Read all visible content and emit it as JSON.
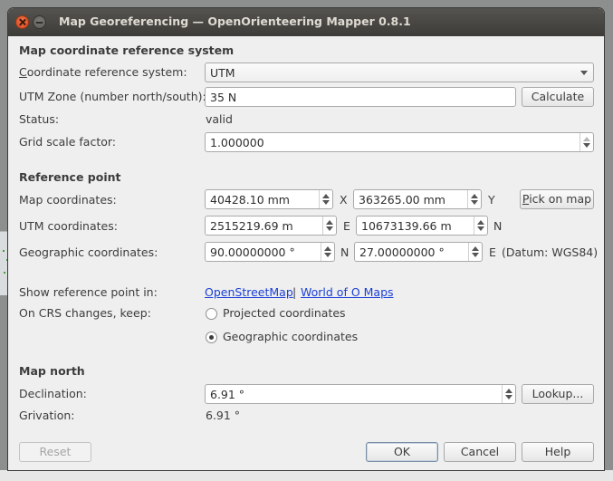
{
  "window": {
    "title": "Map Georeferencing — OpenOrienteering Mapper 0.8.1"
  },
  "crs_section": {
    "heading": "Map coordinate reference system",
    "crs_label_accel": "C",
    "crs_label_rest": "oordinate reference system:",
    "crs_value": "UTM",
    "zone_label": "UTM Zone (number north/south):",
    "zone_value": "35 N",
    "calculate_label": "Calculate",
    "status_label": "Status:",
    "status_value": "valid",
    "grid_scale_label": "Grid scale factor:",
    "grid_scale_value": "1.000000"
  },
  "reference_point": {
    "heading": "Reference point",
    "map_coords_label": "Map coordinates:",
    "map_x_value": "40428.10 mm",
    "map_x_axis": "X",
    "map_y_value": "363265.00 mm",
    "map_y_axis": "Y",
    "pick_label_accel": "P",
    "pick_label_rest": "ick on map",
    "utm_label": "UTM coordinates:",
    "utm_e_value": "2515219.69 m",
    "utm_e_axis": "E",
    "utm_n_value": "10673139.66 m",
    "utm_n_axis": "N",
    "geo_label": "Geographic coordinates:",
    "geo_lat_value": "90.00000000 °",
    "geo_lat_axis": "N",
    "geo_lon_value": "27.00000000 °",
    "geo_lon_axis": "E",
    "datum": "(Datum: WGS84)"
  },
  "options": {
    "show_in_label": "Show reference point in:",
    "osm_link": "OpenStreetMap",
    "separator": "|",
    "woom_link": "World of O Maps",
    "keep_label": "On CRS changes, keep:",
    "radio_projected": "Projected coordinates",
    "radio_geographic": "Geographic coordinates",
    "selected": "geographic"
  },
  "map_north": {
    "heading": "Map north",
    "declination_label": "Declination:",
    "declination_value": "6.91 °",
    "lookup_label": "Lookup...",
    "grivation_label": "Grivation:",
    "grivation_value": "6.91 °"
  },
  "buttons": {
    "reset": "Reset",
    "ok": "OK",
    "cancel": "Cancel",
    "help": "Help"
  }
}
